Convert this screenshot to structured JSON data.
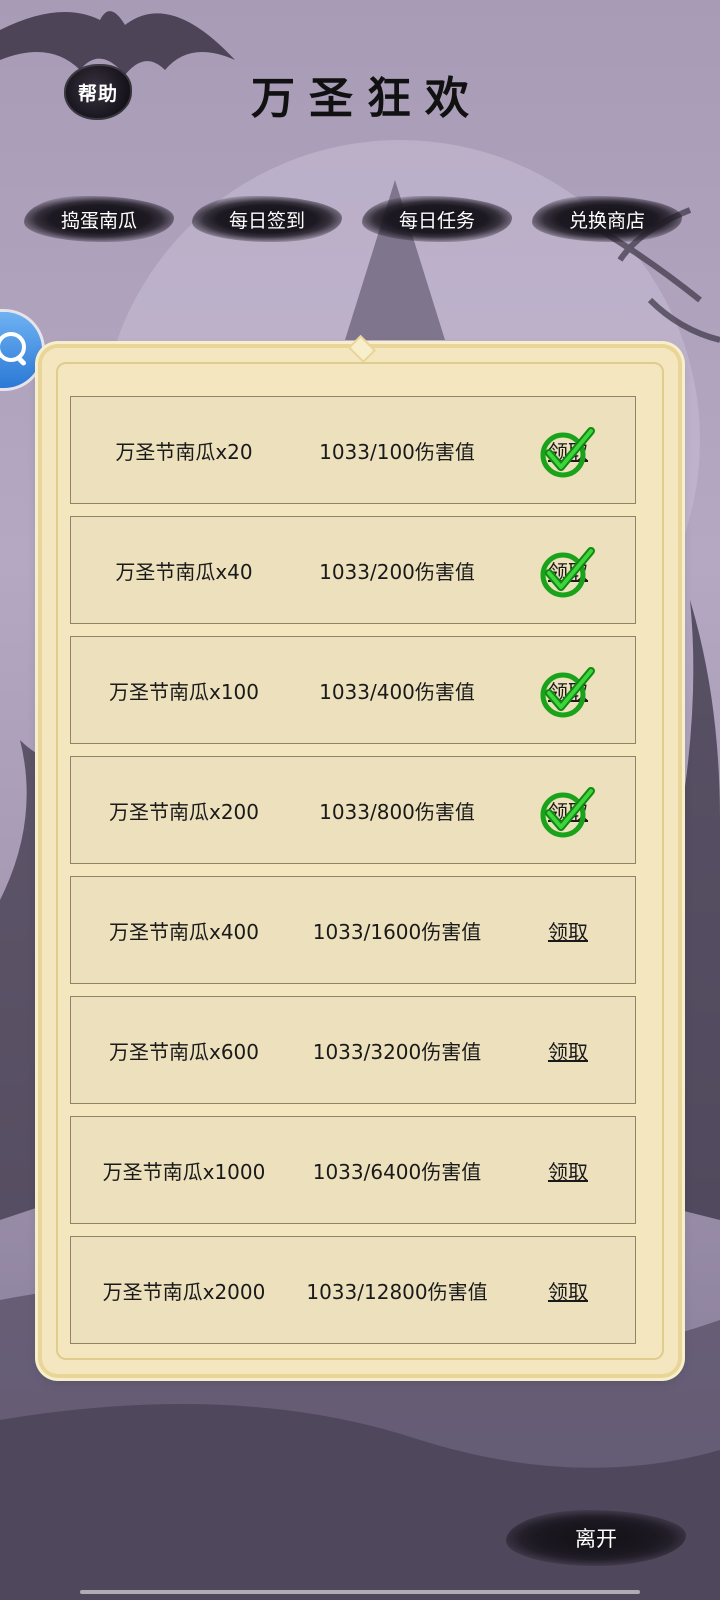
{
  "header": {
    "help_label": "帮助",
    "title": "万圣狂欢"
  },
  "tabs": [
    {
      "label": "捣蛋南瓜"
    },
    {
      "label": "每日签到"
    },
    {
      "label": "每日任务"
    },
    {
      "label": "兑换商店"
    }
  ],
  "rewards": [
    {
      "item": "万圣节南瓜x20",
      "progress": "1033/100伤害值",
      "claim_label": "领取",
      "claimed": true
    },
    {
      "item": "万圣节南瓜x40",
      "progress": "1033/200伤害值",
      "claim_label": "领取",
      "claimed": true
    },
    {
      "item": "万圣节南瓜x100",
      "progress": "1033/400伤害值",
      "claim_label": "领取",
      "claimed": true
    },
    {
      "item": "万圣节南瓜x200",
      "progress": "1033/800伤害值",
      "claim_label": "领取",
      "claimed": true
    },
    {
      "item": "万圣节南瓜x400",
      "progress": "1033/1600伤害值",
      "claim_label": "领取",
      "claimed": false
    },
    {
      "item": "万圣节南瓜x600",
      "progress": "1033/3200伤害值",
      "claim_label": "领取",
      "claimed": false
    },
    {
      "item": "万圣节南瓜x1000",
      "progress": "1033/6400伤害值",
      "claim_label": "领取",
      "claimed": false
    },
    {
      "item": "万圣节南瓜x2000",
      "progress": "1033/12800伤害值",
      "claim_label": "领取",
      "claimed": false
    }
  ],
  "footer": {
    "leave_label": "离开"
  },
  "colors": {
    "panel": "#f4e7bf",
    "row": "#ece0bd",
    "check": "#1aa21a",
    "side_button": "#2b79d6"
  },
  "icons": {
    "help": "help-badge",
    "side": "search-icon",
    "claimed": "check-icon"
  }
}
